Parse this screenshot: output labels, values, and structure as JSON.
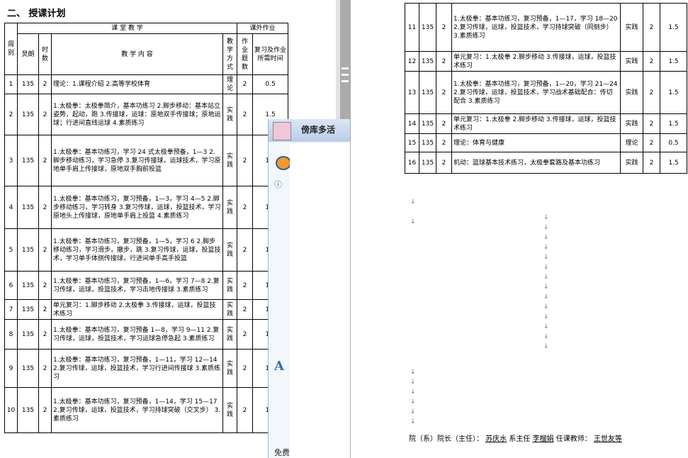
{
  "section_title": "二、   授课计划",
  "table_header": {
    "week": "周别",
    "class_group": "课   堂   教   学",
    "extra_group": "课外作业",
    "semester": "炅朗",
    "hours": "时数",
    "content": "教  学  内  容",
    "method": "教学方式",
    "hw_count": "作业题数",
    "review_time": "复习及作业所需时间"
  },
  "left_rows": [
    {
      "week": "1",
      "sem": "135",
      "hours": "2",
      "content": "理论：1.课程介绍   2.高等学校体育",
      "method": "理论",
      "hw": "2",
      "time": "0.5"
    },
    {
      "week": "2",
      "sem": "135",
      "hours": "2",
      "content": "1.太极拳：太极拳简介，基本功练习   2.脚步移动：基本站立姿势，起动，跑   3.传接球，运球：原地双手传接球；原地运球；行进间直线运球 4.素质练习",
      "method": "实践",
      "hw": "2",
      "time": "1.5"
    },
    {
      "week": "3",
      "sem": "135",
      "hours": "2",
      "content": "1.太极拳：基本功练习，学习 24 式太极拳预备，1—3   2.脚步移动练习，学习急停   3.复习传接球，运球技术，学习原地单手肩上传接球，原地双手胸前投篮",
      "method": "实践",
      "hw": "2",
      "time": "1.5"
    },
    {
      "week": "4",
      "sem": "135",
      "hours": "2",
      "content": "1.太极拳：基本功练习，复习预备，1—3，学习 4—5 2.脚步移动练习，学习转身   3.复习传球，运球，投篮技术，学习原地头上传接球，原地单手肩上投篮 4.素质练习",
      "method": "实践",
      "hw": "2",
      "time": "1.5"
    },
    {
      "week": "5",
      "sem": "135",
      "hours": "2",
      "content": "1.太极拳：基本功练习，复习预备，1—5，学习 6  2.脚步移动练习，学习滑步，撤步，跳   3.复习传球，运球，投篮技术，学习单手体侧传接球，行进间单手高手投篮",
      "method": "实践",
      "hw": "2",
      "time": "1.5"
    },
    {
      "week": "6",
      "sem": "135",
      "hours": "2",
      "content": "1.太极拳：基本功练习，复习预备，1—6，学习 7—8 2.复习传球，运球，投篮技术，学习击地传接球 3.素质练习",
      "method": "实践",
      "hw": "2",
      "time": "1.5"
    },
    {
      "week": "7",
      "sem": "135",
      "hours": "2",
      "content": "单元复习：1.脚步移动  2.太极拳 3.传接球，运球，投篮技术练习",
      "method": "实践",
      "hw": "2",
      "time": "1.5"
    },
    {
      "week": "8",
      "sem": "135",
      "hours": "2",
      "content": "1.太极拳：基本功练习，复习预备 1—8，学习 9—11  2.复习传球，运球，投篮技术，学习运球急停急起  3.素质练习",
      "method": "实践",
      "hw": "2",
      "time": "1.5"
    },
    {
      "week": "9",
      "sem": "135",
      "hours": "2",
      "content": "1.太极拳：基本功练习，复习预备，1—11，学习 12—14   2.复习传球，运球，投篮技术，学习行进间传接球  3.素质练习",
      "method": "实践",
      "hw": "2",
      "time": "1.5"
    },
    {
      "week": "10",
      "sem": "135",
      "hours": "2",
      "content": "1.太极拳：基本功练习，复习预备，1—14，学习 15—17  2.复习传球，运球，投篮技术，学习持球突破（交叉步） 3.素质练习",
      "method": "实践",
      "hw": "2",
      "time": "1.5"
    }
  ],
  "right_rows": [
    {
      "week": "11",
      "sem": "135",
      "hours": "2",
      "content": "1.太极拳：基本功练习，复习预备，1—17，学习 18—20   2.复习传球，运球，投篮技术，学习持球突破（同侧步）  3.素质练习",
      "method": "实践",
      "hw": "2",
      "time": "1.5"
    },
    {
      "week": "12",
      "sem": "135",
      "hours": "2",
      "content": "单元复习：1.太极拳  2.脚步移动  3.传接球，运球，投篮技术练习",
      "method": "实践",
      "hw": "2",
      "time": "1.5"
    },
    {
      "week": "13",
      "sem": "135",
      "hours": "2",
      "content": "1.太极拳：基本功练习，复习预备，1—20，学习 21—24  2.复习传球，运球，投篮技术，学习战术基础配合：传切配合  3.素质练习",
      "method": "实践",
      "hw": "2",
      "time": "1.5"
    },
    {
      "week": "14",
      "sem": "135",
      "hours": "2",
      "content": "单元复习：1.太极拳  2.脚步移动  3.传接球，运球，投篮技术练习",
      "method": "实践",
      "hw": "2",
      "time": "1.5"
    },
    {
      "week": "15",
      "sem": "135",
      "hours": "2",
      "content": "理论：体育与健康",
      "method": "理论",
      "hw": "2",
      "time": "0.5"
    },
    {
      "week": "16",
      "sem": "135",
      "hours": "2",
      "content": "机动：篮球基本技术练习，太极拳套路及基本功练习",
      "method": "实践",
      "hw": "2",
      "time": "1.5"
    }
  ],
  "signature": {
    "dean_label": "院（系）院长（主任）：",
    "dean_name": "苏庆水",
    "director_label": "系主任",
    "director_name": "李榴娟",
    "teacher_label": "任课教师：",
    "teacher_name": "王世友等"
  },
  "popup": {
    "title": "傍库多活",
    "footer": "免费"
  }
}
